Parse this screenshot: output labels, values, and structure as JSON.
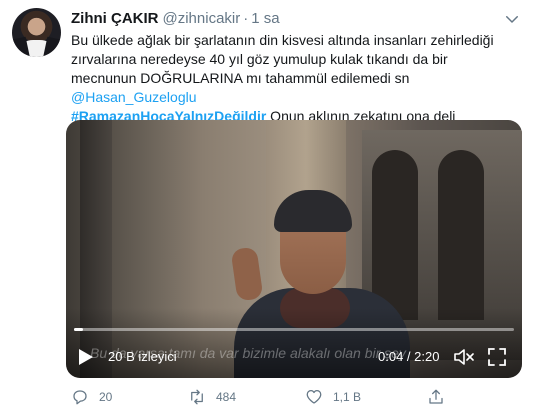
{
  "tweet": {
    "author_name": "Zihni ÇAKIR",
    "handle": "@zihnicakir",
    "separator": "·",
    "time": "1 sa",
    "text_part1": "Bu ülkede ağlak bir şarlatanın din kisvesi altında insanları zehirlediği zırvalarına neredeyse 40 yıl göz yumulup kulak tıkandı da bir mecnunun DOĞRULARINA mı tahammül edilemedi sn ",
    "mention": "@Hasan_Guzeloglu",
    "hashtag": "#RamazanHocaYalnızDeğildir",
    "text_part2": " Onun aklının zekatını ona deli diyenlerde var mı acep"
  },
  "video": {
    "subtitle": "Bu da varsa tamı da var bizimle alakalı olan bir şey",
    "views": "20 B izleyici",
    "duration": "0:04 / 2:20",
    "progress_fraction": 0.02
  },
  "actions": {
    "replies": "20",
    "retweets": "484",
    "likes": "1,1 B"
  },
  "colors": {
    "accent": "#1da1f2",
    "secondary_text": "#657786",
    "primary_text": "#14171a"
  },
  "icons": {
    "reply": "reply-icon",
    "retweet": "retweet-icon",
    "like": "heart-icon",
    "share": "share-icon",
    "play": "play-icon",
    "volume": "volume-muted-icon",
    "fullscreen": "fullscreen-icon",
    "caret": "chevron-down-icon"
  }
}
